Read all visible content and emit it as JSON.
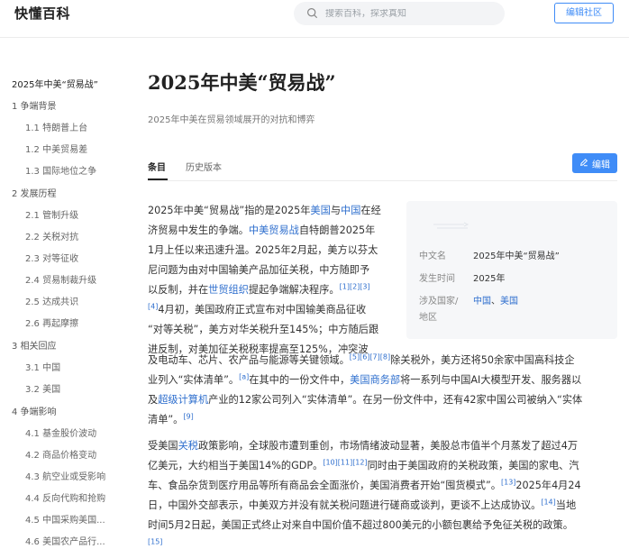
{
  "header": {
    "logo": "快懂百科",
    "search_placeholder": "搜索百科，探求真知",
    "edit_community": "编辑社区"
  },
  "toc": [
    {
      "label": "2025年中美“贸易战”",
      "level": 1,
      "active": true
    },
    {
      "label": "1 争端背景",
      "level": 1
    },
    {
      "label": "1.1 特朗普上台",
      "level": 2
    },
    {
      "label": "1.2 中美贸易差",
      "level": 2
    },
    {
      "label": "1.3 国际地位之争",
      "level": 2
    },
    {
      "label": "2 发展历程",
      "level": 1
    },
    {
      "label": "2.1 管制升级",
      "level": 2
    },
    {
      "label": "2.2 关税对抗",
      "level": 2
    },
    {
      "label": "2.3 对等征收",
      "level": 2
    },
    {
      "label": "2.4 贸易制裁升级",
      "level": 2
    },
    {
      "label": "2.5 达成共识",
      "level": 2
    },
    {
      "label": "2.6 再起摩擦",
      "level": 2
    },
    {
      "label": "3 相关回应",
      "level": 1
    },
    {
      "label": "3.1 中国",
      "level": 2
    },
    {
      "label": "3.2 美国",
      "level": 2
    },
    {
      "label": "4 争端影响",
      "level": 1
    },
    {
      "label": "4.1 基金股价波动",
      "level": 2
    },
    {
      "label": "4.2 商品价格变动",
      "level": 2
    },
    {
      "label": "4.3 航空业或受影响",
      "level": 2
    },
    {
      "label": "4.4 反向代购和抢购",
      "level": 2
    },
    {
      "label": "4.5 中国采购美国...",
      "level": 2
    },
    {
      "label": "4.6 美国农产品行...",
      "level": 2
    }
  ],
  "article": {
    "title": "2025年中美“贸易战”",
    "subtitle": "2025年中美在贸易领域展开的对抗和博弈",
    "tabs": [
      "条目",
      "历史版本"
    ],
    "edit_button": "编辑"
  },
  "infobox": {
    "rows": [
      {
        "label": "中文名",
        "value": "2025年中美“贸易战”"
      },
      {
        "label": "发生时间",
        "value": "2025年"
      },
      {
        "label": "涉及国家/",
        "label2": "地区",
        "value_links": [
          "中国",
          "美国"
        ],
        "sep": "、"
      }
    ]
  },
  "content": {
    "p1_lines": [
      [
        {
          "t": "2025年中美“贸易战”指的是2025年"
        },
        {
          "t": "美国",
          "link": true
        },
        {
          "t": "与"
        },
        {
          "t": "中国",
          "link": true
        },
        {
          "t": "在经"
        }
      ],
      [
        {
          "t": "济贸易中发生的争端。"
        },
        {
          "t": "中美贸易战",
          "link": true
        },
        {
          "t": "自特朗普2025年"
        }
      ],
      [
        {
          "t": "1月上任以来迅速升温。2025年2月起，美方以芬太"
        }
      ],
      [
        {
          "t": "尼问题为由对中国输美产品加征关税，中方随即予"
        }
      ],
      [
        {
          "t": "以反制，并在"
        },
        {
          "t": "世贸组织",
          "link": true
        },
        {
          "t": "提起争端解决程序。"
        },
        {
          "t": "[1][2][3]",
          "ref": true
        }
      ],
      [
        {
          "t": "[4]",
          "ref": true
        },
        {
          "t": "4月初，美国政府正式宣布对中国输美商品征收"
        }
      ],
      [
        {
          "t": "“对等关税”，美方对华关税升至145%；中方随后跟"
        }
      ],
      [
        {
          "t": "进反制，对美加征关税税率提高至125%，冲突波"
        }
      ]
    ],
    "p1_wide_lines": [
      [
        {
          "t": "及电动车、芯片、农产品与能源等关键领域。"
        },
        {
          "t": "[5][6][7][8]",
          "ref": true
        },
        {
          "t": "除关税外，美方还将50余家中国高科技企"
        }
      ],
      [
        {
          "t": "业列入“实体清单”。"
        },
        {
          "t": "[a]",
          "ref": true
        },
        {
          "t": "在其中的一份文件中，"
        },
        {
          "t": "美国商务部",
          "link": true
        },
        {
          "t": "将一系列与中国AI大模型开发、服务器以"
        }
      ],
      [
        {
          "t": "及"
        },
        {
          "t": "超级计算机",
          "link": true
        },
        {
          "t": "产业的12家公司列入“实体清单”。在另一份文件中，还有42家中国公司被纳入“实体"
        }
      ],
      [
        {
          "t": "清单”。"
        },
        {
          "t": "[9]",
          "ref": true
        }
      ]
    ],
    "p2_lines": [
      [
        {
          "t": "受美国"
        },
        {
          "t": "关税",
          "link": true
        },
        {
          "t": "政策影响，全球股市遭到重创，市场情绪波动显著，美股总市值半个月蒸发了超过4万"
        }
      ],
      [
        {
          "t": "亿美元，大约相当于美国14%的GDP。"
        },
        {
          "t": "[10][11][12]",
          "ref": true
        },
        {
          "t": "同时由于美国政府的关税政策，美国的家电、汽"
        }
      ],
      [
        {
          "t": "车、食品杂货到医疗用品等所有商品会全面涨价，美国消费者开始“囤货模式”。"
        },
        {
          "t": "[13]",
          "ref": true
        },
        {
          "t": "2025年4月24"
        }
      ],
      [
        {
          "t": "日，中国外交部表示，中美双方并没有就关税问题进行磋商或谈判，更谈不上达成协议。"
        },
        {
          "t": "[14]",
          "ref": true
        },
        {
          "t": "当地"
        }
      ],
      [
        {
          "t": "时间5月2日起，美国正式终止对来自中国价值不超过800美元的小额包裹给予免征关税的政策。"
        }
      ],
      [
        {
          "t": "[15]",
          "ref": true
        }
      ]
    ]
  }
}
